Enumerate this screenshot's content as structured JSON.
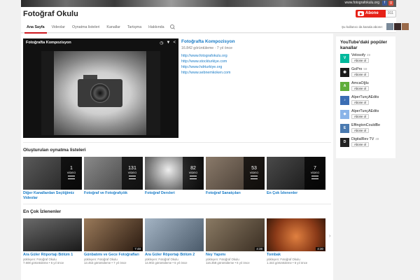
{
  "banner": {
    "url": "www.fotografokulu.org"
  },
  "channel": {
    "title": "Fotoğraf Okulu",
    "subscribe_label": "Abone ol",
    "subscriber_count": "911"
  },
  "tabs": [
    {
      "label": "Ana Sayfa"
    },
    {
      "label": "Videolar"
    },
    {
      "label": "Oynatma listeleri"
    },
    {
      "label": "Kanallar"
    },
    {
      "label": "Tartışma"
    },
    {
      "label": "Hakkında"
    }
  ],
  "also_subscribed_label": "Şu kullanıcı da kanala abone:",
  "featured": {
    "player_title": "Fotoğrafta Kompozisyon",
    "title": "Fotoğrafta Kompozisyon",
    "meta": "16.842 görüntüleme · 7 yıl önce",
    "links": [
      "http://www.fotografokulu.org",
      "http://www.stockturkiye.com",
      "http://www.hdrturkiye.org",
      "http://www.sebnemkoken.com"
    ]
  },
  "playlists_section": {
    "title": "Oluşturulan oynatma listeleri",
    "video_word": "VİDEO",
    "items": [
      {
        "title": "Diğer Kanallardan Seçtiğimiz Videolar",
        "count": "1",
        "bg": "#3a3a3a"
      },
      {
        "title": "Fotoğraf ve Fotoğrafçılık",
        "count": "131",
        "bg": "#6b6b6b"
      },
      {
        "title": "Fotoğraf Dersleri",
        "count": "82",
        "bg": "#9a9a9a"
      },
      {
        "title": "Fotoğraf Sanatçıları",
        "count": "53",
        "bg": "#7d6a5a"
      },
      {
        "title": "En Çok İzlenenler",
        "count": "7",
        "bg": "#2e2e2e"
      }
    ]
  },
  "popular_section": {
    "title": "En Çok İzlenenler",
    "items": [
      {
        "title": "Ara Güler Röportajı Bölüm 1",
        "uploader": "yükleyen: Fotoğraf Okulu",
        "stats": "7.608 görüntüleme • 6 yıl önce",
        "duration": "",
        "bg": "#2a2a2a"
      },
      {
        "title": "Günbatımı ve Gece Fotoğrafları",
        "uploader": "yükleyen: Fotoğraf Okulu",
        "stats": "13.453 görüntüleme • 7 yıl önce",
        "duration": "7:48",
        "bg": "#5a4030"
      },
      {
        "title": "Ara Güler Röportajı Bölüm 2",
        "uploader": "yükleyen: Fotoğraf Okulu",
        "stats": "14.902 görüntüleme • 6 yıl önce",
        "duration": "",
        "bg": "#6d7b8c"
      },
      {
        "title": "Ney Yapımı",
        "uploader": "yükleyen: Fotoğraf Okulu",
        "stats": "116.358 görüntüleme • 6 yıl önce",
        "duration": "4:38",
        "bg": "#6a5a48"
      },
      {
        "title": "Tombak",
        "uploader": "yükleyen: Fotoğraf Okulu",
        "stats": "1.344 görüntüleme • 6 yıl önce",
        "duration": "4:30",
        "bg": "#a8502a"
      }
    ]
  },
  "sidebar": {
    "title": "YouTube'daki popüler kanallar",
    "subscribe_label": "Abone ol",
    "channels": [
      {
        "name": "Velosofy",
        "count": "49",
        "color": "#00b89c",
        "glyph": "V"
      },
      {
        "name": "GoPro",
        "count": "59",
        "color": "#1a1a1a",
        "glyph": "◉"
      },
      {
        "name": "AmcaOğlu",
        "count": "",
        "color": "#5fae3a",
        "glyph": "A"
      },
      {
        "name": "AlperTunçAEdits",
        "count": "",
        "color": "#3b6db3",
        "glyph": "♪"
      },
      {
        "name": "AlperTunçAEdits",
        "count": "",
        "color": "#8ab4e8",
        "glyph": "◆"
      },
      {
        "name": "EffingtonCouldBe",
        "count": "",
        "color": "#4a7ab0",
        "glyph": "E"
      },
      {
        "name": "DigitalRev TV",
        "count": "49",
        "color": "#222222",
        "glyph": "D"
      }
    ]
  }
}
